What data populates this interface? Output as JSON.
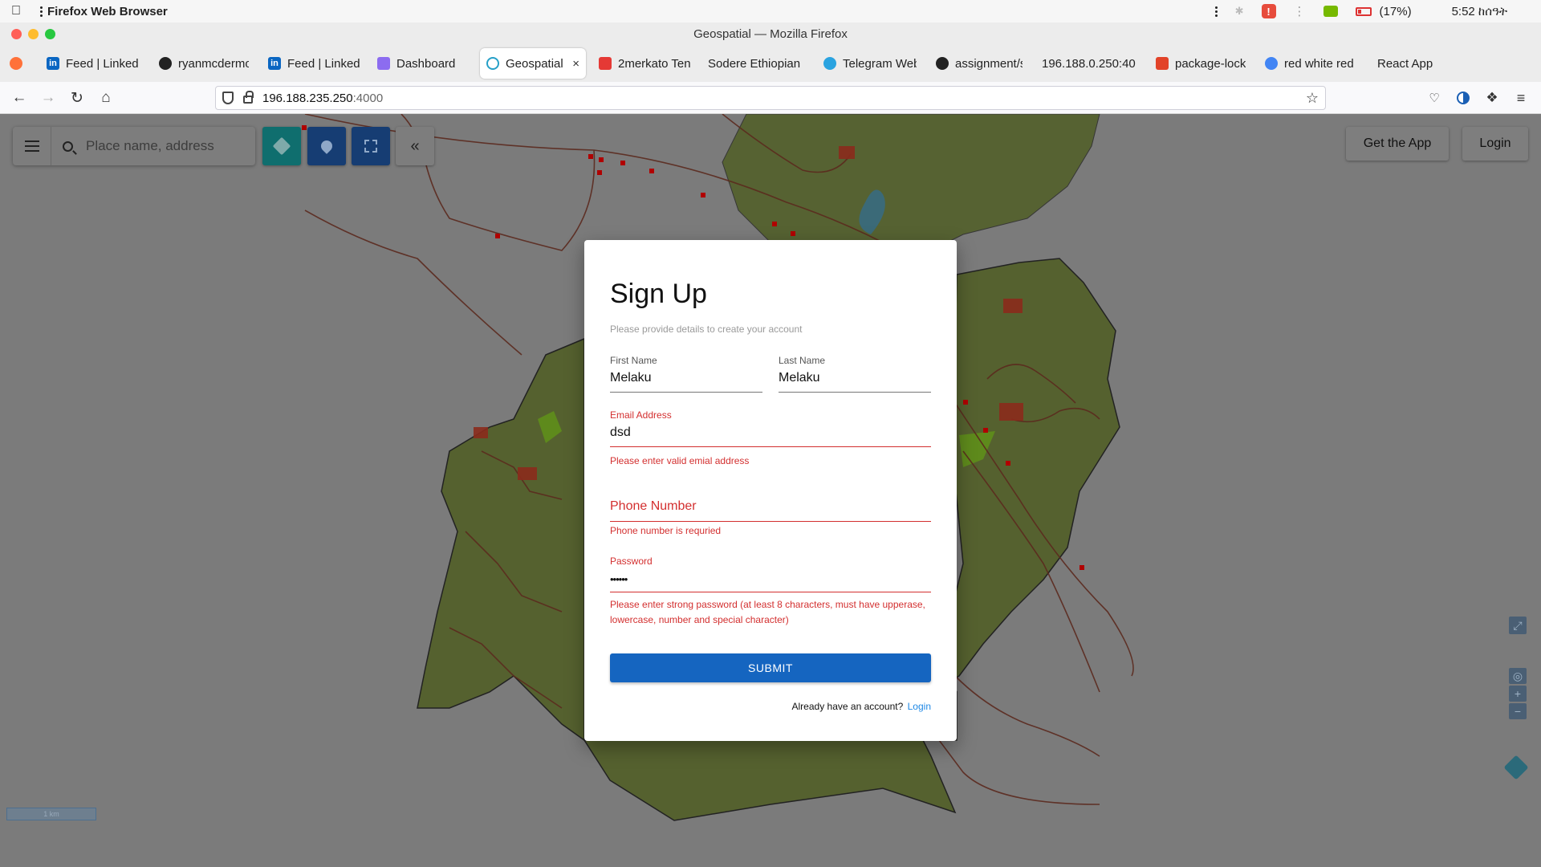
{
  "os": {
    "app_name": "Firefox Web Browser",
    "battery": "(17%)",
    "time": "5:52 ከሰዓት"
  },
  "window": {
    "title": "Geospatial — Mozilla Firefox"
  },
  "tabs": [
    {
      "label": "Feed | LinkedI",
      "icon": "linkedin-icon",
      "color": "#0a66c2"
    },
    {
      "label": "ryanmcdermo",
      "icon": "github-icon",
      "color": "#222222"
    },
    {
      "label": "Feed | LinkedI",
      "icon": "linkedin-icon",
      "color": "#0a66c2"
    },
    {
      "label": "Dashboard",
      "icon": "vite-icon",
      "color": "#8c6cf0"
    },
    {
      "label": "Geospatial",
      "icon": "react-icon",
      "color": "#26a0c8"
    },
    {
      "label": "2merkato Ten",
      "icon": "2merkato-icon",
      "color": "#e53935"
    },
    {
      "label": "Sodere Ethiopian",
      "icon": "",
      "color": ""
    },
    {
      "label": "Telegram Web",
      "icon": "telegram-icon",
      "color": "#2aa3e0"
    },
    {
      "label": "assignment/sc",
      "icon": "github-icon",
      "color": "#222222"
    },
    {
      "label": "196.188.0.250:40",
      "icon": "",
      "color": ""
    },
    {
      "label": "package-lock.j",
      "icon": "gitlab-icon",
      "color": "#e24329"
    },
    {
      "label": "red white red",
      "icon": "google-icon",
      "color": "#4285f4"
    },
    {
      "label": "React App",
      "icon": "",
      "color": ""
    }
  ],
  "url": {
    "host": "196.188.235.250",
    "port": ":4000"
  },
  "map": {
    "search_placeholder": "Place name, address",
    "get_app_label": "Get the App",
    "login_label": "Login",
    "scale_label": "1 km"
  },
  "signup": {
    "title": "Sign Up",
    "subtitle": "Please provide details to create your account",
    "first_name": {
      "label": "First Name",
      "value": "Melaku"
    },
    "last_name": {
      "label": "Last Name",
      "value": "Melaku"
    },
    "email": {
      "label": "Email Address",
      "value": "dsd",
      "error": "Please enter valid emial address"
    },
    "phone": {
      "label": "Phone Number",
      "error": "Phone number is requried"
    },
    "password": {
      "label": "Password",
      "value": "••••••",
      "error": "Please enter strong password (at least 8 characters, must have upperase, lowercase, number and special character)"
    },
    "submit_label": "SUBMIT",
    "already_text": "Already have an account?",
    "login_link": "Login"
  },
  "colors": {
    "primary": "#1565c0",
    "error": "#d32f2f",
    "map_land": "#55612f",
    "map_road": "#5b2a1e",
    "map_marker": "#8b0000"
  }
}
